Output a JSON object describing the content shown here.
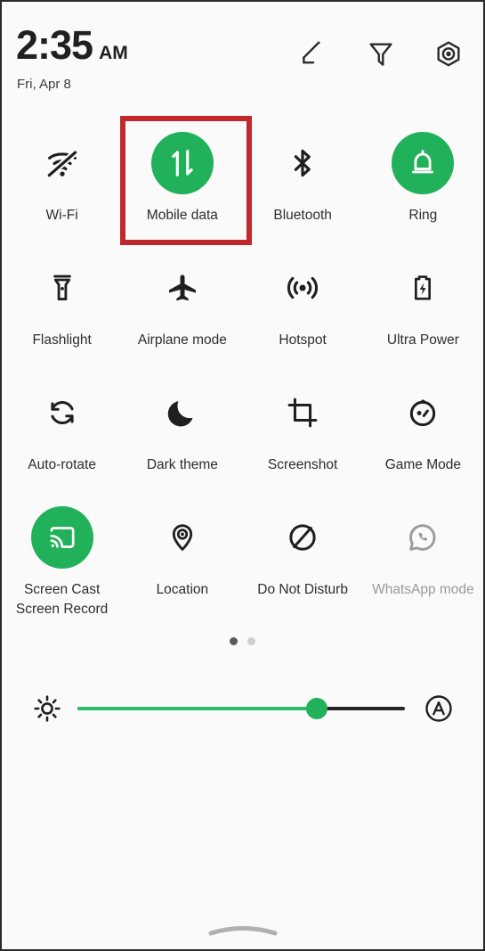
{
  "status": {
    "time": "2:35",
    "ampm": "AM",
    "date": "Fri, Apr 8"
  },
  "header_icons": [
    {
      "name": "edit-icon",
      "label": "Edit"
    },
    {
      "name": "filter-icon",
      "label": "Filter"
    },
    {
      "name": "settings-icon",
      "label": "Settings"
    }
  ],
  "tiles": [
    {
      "label": "Wi-Fi",
      "icon": "wifi-off-icon",
      "state": "off"
    },
    {
      "label": "Mobile data",
      "icon": "mobile-data-icon",
      "state": "on",
      "highlighted": true
    },
    {
      "label": "Bluetooth",
      "icon": "bluetooth-icon",
      "state": "off"
    },
    {
      "label": "Ring",
      "icon": "bell-icon",
      "state": "on"
    },
    {
      "label": "Flashlight",
      "icon": "flashlight-icon",
      "state": "off"
    },
    {
      "label": "Airplane mode",
      "icon": "airplane-icon",
      "state": "off"
    },
    {
      "label": "Hotspot",
      "icon": "hotspot-icon",
      "state": "off"
    },
    {
      "label": "Ultra Power",
      "icon": "battery-bolt-icon",
      "state": "off"
    },
    {
      "label": "Auto-rotate",
      "icon": "auto-rotate-icon",
      "state": "off"
    },
    {
      "label": "Dark theme",
      "icon": "moon-icon",
      "state": "off"
    },
    {
      "label": "Screenshot",
      "icon": "screenshot-icon",
      "state": "off"
    },
    {
      "label": "Game Mode",
      "icon": "game-mode-icon",
      "state": "off"
    },
    {
      "label": "Screen Cast\nScreen Record",
      "icon": "screen-cast-icon",
      "state": "on"
    },
    {
      "label": "Location",
      "icon": "location-pin-icon",
      "state": "off"
    },
    {
      "label": "Do Not Disturb",
      "icon": "do-not-disturb-icon",
      "state": "off"
    },
    {
      "label": "WhatsApp mode",
      "icon": "whatsapp-icon",
      "state": "disabled"
    }
  ],
  "pager": {
    "total": 2,
    "active_index": 0
  },
  "brightness": {
    "value_percent": 73,
    "sun_icon": "brightness-sun-icon",
    "auto_icon": "auto-brightness-icon",
    "auto_label": "A"
  },
  "colors": {
    "accent_green": "#21b15a",
    "slider_green": "#2bbd69",
    "highlight_red": "#c0282d",
    "icon_dark": "#1f1f1f",
    "label_text": "#2e2e2e",
    "disabled_text": "#9b9b9b",
    "background": "#fafafa"
  },
  "gesture_bar": {
    "name": "home-gesture-handle"
  }
}
